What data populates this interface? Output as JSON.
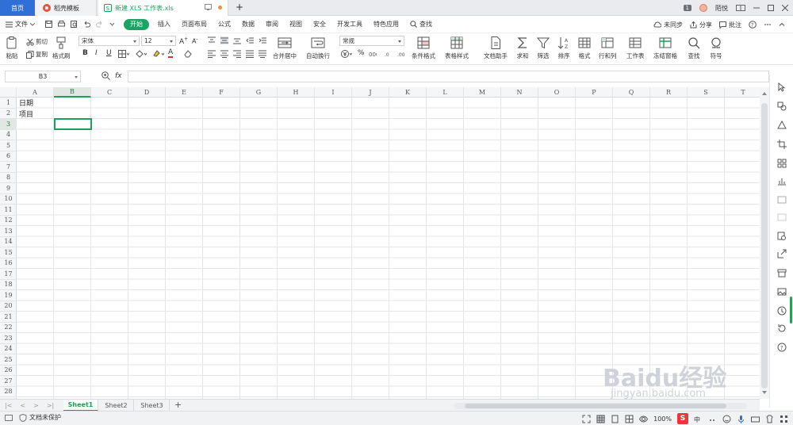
{
  "tabs": {
    "home": "首页",
    "templates": "稻壳模板",
    "document": "新建 XLS 工作表.xls",
    "new_tab": "+"
  },
  "window": {
    "badge": "1",
    "user": "陌悦"
  },
  "menu": {
    "file": "文件",
    "items": [
      "开始",
      "插入",
      "页面布局",
      "公式",
      "数据",
      "审阅",
      "视图",
      "安全",
      "开发工具",
      "特色应用"
    ],
    "search": "查找",
    "right": [
      "未同步",
      "分享",
      "批注"
    ]
  },
  "ribbon": {
    "paste": "粘贴",
    "cut": "剪切",
    "copy": "复制",
    "format_painter": "格式刷",
    "font_name": "宋体",
    "font_size": "12",
    "bold": "B",
    "italic": "I",
    "underline": "U",
    "font_color_letter": "A",
    "merge_center": "合并居中",
    "wrap_text": "自动换行",
    "number_format": "常规",
    "percent": "%",
    "conditional_format": "条件格式",
    "table_style": "表格样式",
    "doc_assistant": "文档助手",
    "sum": "求和",
    "filter": "筛选",
    "sort": "排序",
    "format": "格式",
    "rows_cols": "行和列",
    "worksheet": "工作表",
    "freeze": "冻结窗格",
    "find": "查找",
    "symbol": "符号"
  },
  "formula_bar": {
    "name_box": "B3",
    "fx": "fx",
    "value": ""
  },
  "sheet": {
    "columns": [
      "A",
      "B",
      "C",
      "D",
      "E",
      "F",
      "G",
      "H",
      "I",
      "J",
      "K",
      "L",
      "M",
      "N",
      "O",
      "P",
      "Q",
      "R",
      "S",
      "T"
    ],
    "rows": [
      "1",
      "2",
      "3",
      "4",
      "5",
      "6",
      "7",
      "8",
      "9",
      "10",
      "11",
      "12",
      "13",
      "14",
      "15",
      "16",
      "17",
      "18",
      "19",
      "20",
      "21",
      "22",
      "23",
      "24",
      "25",
      "26",
      "27",
      "28"
    ],
    "selected_cell": "B3",
    "cells": [
      {
        "ref": "A1",
        "value": "日期"
      },
      {
        "ref": "A2",
        "value": "项目"
      }
    ]
  },
  "sheet_tabs": [
    "Sheet1",
    "Sheet2",
    "Sheet3"
  ],
  "sheet_add": "+",
  "status": {
    "protect": "文档未保护",
    "zoom": "100%",
    "ime_logo": "S"
  },
  "watermark": {
    "brand": "Baidu经验",
    "url": "jingyan.baidu.com"
  },
  "colors": {
    "accent": "#1e9e58",
    "home_tab": "#2f6fd6",
    "menu_active": "#1aa463"
  }
}
